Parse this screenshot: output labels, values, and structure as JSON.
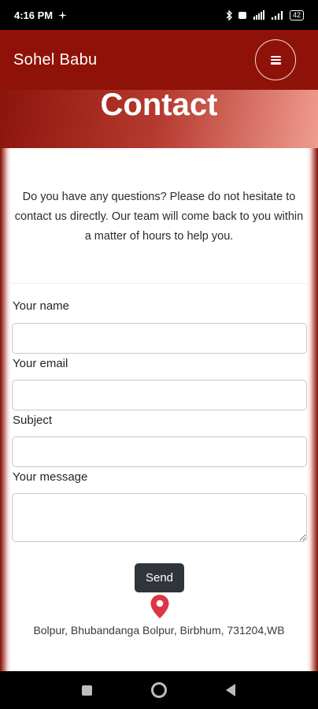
{
  "status_bar": {
    "time": "4:16 PM",
    "battery": "42"
  },
  "navbar": {
    "brand": "Sohel Babu"
  },
  "hero": {
    "title": "Contact"
  },
  "intro": "Do you have any questions? Please do not hesitate to contact us directly. Our team will come back to you within a matter of hours to help you.",
  "form": {
    "name_label": "Your name",
    "name_value": "",
    "email_label": "Your email",
    "email_value": "",
    "subject_label": "Subject",
    "subject_value": "",
    "message_label": "Your message",
    "message_value": "",
    "send_label": "Send"
  },
  "address": "Bolpur, Bhubandanga Bolpur, Birbhum, 731204,WB",
  "colors": {
    "navbar_bg": "#8f1208",
    "pin": "#dc3545",
    "send_bg": "#30343b"
  }
}
